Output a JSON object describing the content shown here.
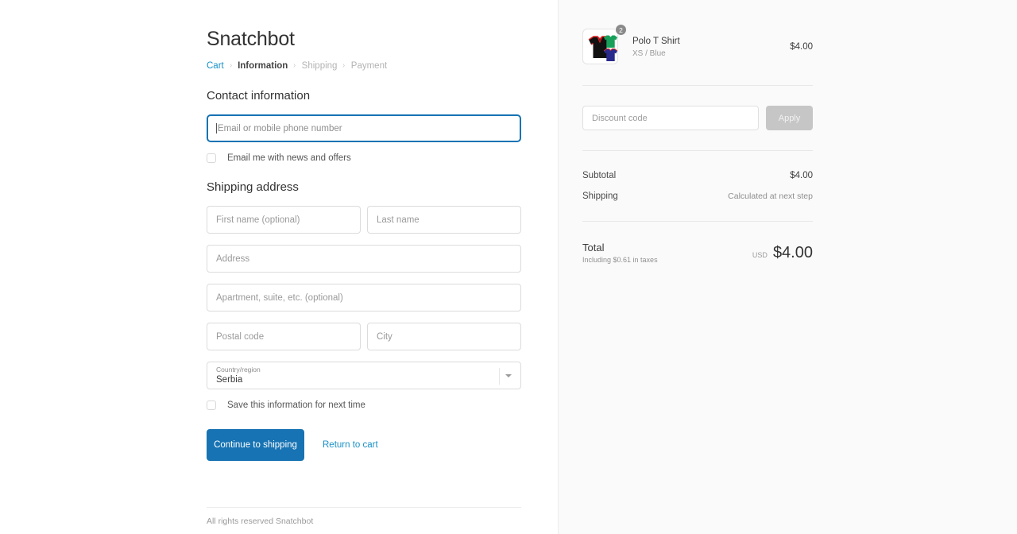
{
  "brand": {
    "name": "Snatchbot"
  },
  "breadcrumb": {
    "items": [
      {
        "label": "Cart",
        "state": "link"
      },
      {
        "label": "Information",
        "state": "current"
      },
      {
        "label": "Shipping",
        "state": "muted"
      },
      {
        "label": "Payment",
        "state": "muted"
      }
    ],
    "separator": "›"
  },
  "contact": {
    "heading": "Contact information",
    "email_placeholder": "Email or mobile phone number",
    "email_value": "",
    "newsletter_label": "Email me with news and offers",
    "newsletter_checked": false
  },
  "shipping": {
    "heading": "Shipping address",
    "first_name_placeholder": "First name (optional)",
    "last_name_placeholder": "Last name",
    "address_placeholder": "Address",
    "apartment_placeholder": "Apartment, suite, etc. (optional)",
    "postal_placeholder": "Postal code",
    "city_placeholder": "City",
    "country_label": "Country/region",
    "country_value": "Serbia",
    "save_label": "Save this information for next time",
    "save_checked": false
  },
  "actions": {
    "continue_label": "Continue to shipping",
    "return_label": "Return to cart"
  },
  "footer": {
    "text": "All rights reserved Snatchbot"
  },
  "order": {
    "item": {
      "title": "Polo T Shirt",
      "variant": "XS / Blue",
      "price": "$4.00",
      "quantity": "2",
      "thumbnail_icon": "polo-shirt-icon"
    },
    "discount": {
      "placeholder": "Discount code",
      "value": "",
      "apply_label": "Apply",
      "apply_disabled": true
    },
    "subtotal_label": "Subtotal",
    "subtotal_value": "$4.00",
    "shipping_label": "Shipping",
    "shipping_value": "Calculated at next step",
    "total_label": "Total",
    "total_taxes": "Including $0.61 in taxes",
    "total_currency": "USD",
    "total_value": "$4.00"
  },
  "colors": {
    "accent": "#1773b3",
    "link": "#1990c6",
    "panel_bg": "#fafafa",
    "disabled": "#c6c6c6",
    "badge": "#8a8a8a"
  }
}
